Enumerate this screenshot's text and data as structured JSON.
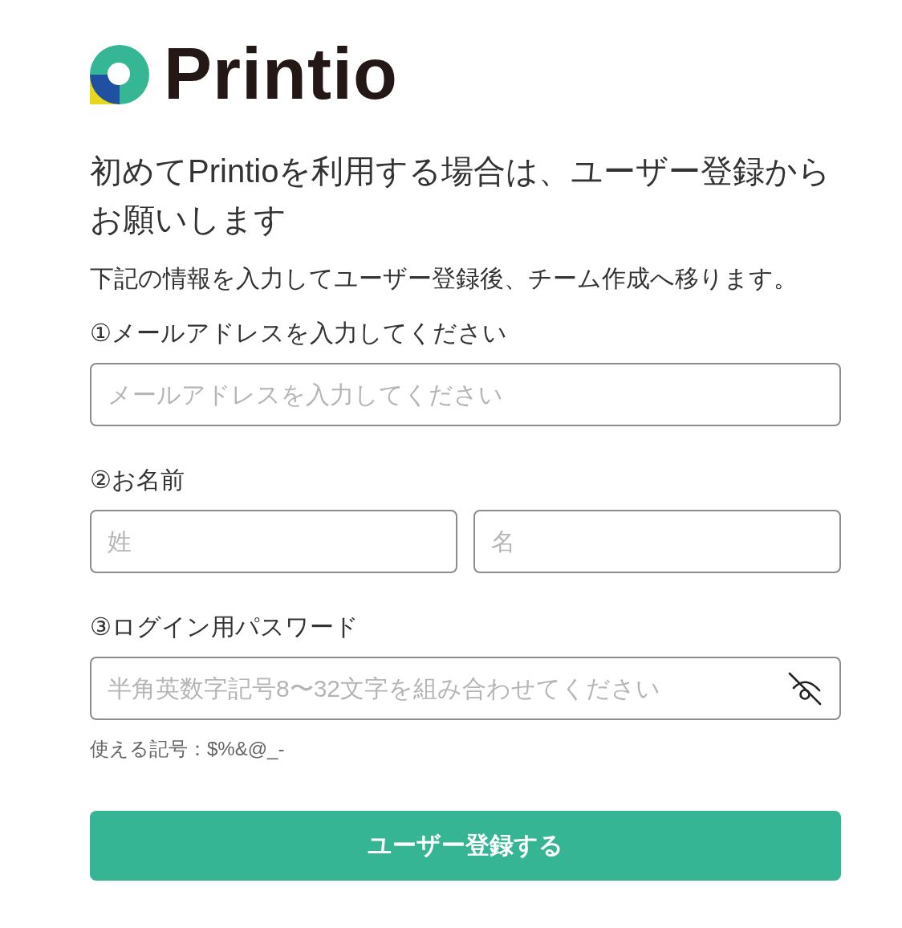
{
  "logo": {
    "text": "Printio"
  },
  "heading": "初めてPrintioを利用する場合は、ユーザー登録からお願いします",
  "description": "下記の情報を入力してユーザー登録後、チーム作成へ移ります。",
  "sections": [
    {
      "label": "①メールアドレスを入力してください",
      "fields": [
        {
          "kind": "email",
          "placeholder": "メールアドレスを入力してください"
        }
      ]
    },
    {
      "label": "②お名前",
      "fields": [
        {
          "kind": "last-name",
          "placeholder": "姓"
        },
        {
          "kind": "first-name",
          "placeholder": "名"
        }
      ]
    },
    {
      "label": "③ログイン用パスワード",
      "fields": [
        {
          "kind": "password",
          "placeholder": "半角英数字記号8〜32文字を組み合わせてください",
          "show_password": false
        }
      ],
      "note": "使える記号：$%&@_-"
    }
  ],
  "submit_button": {
    "label": "ユーザー登録する"
  }
}
